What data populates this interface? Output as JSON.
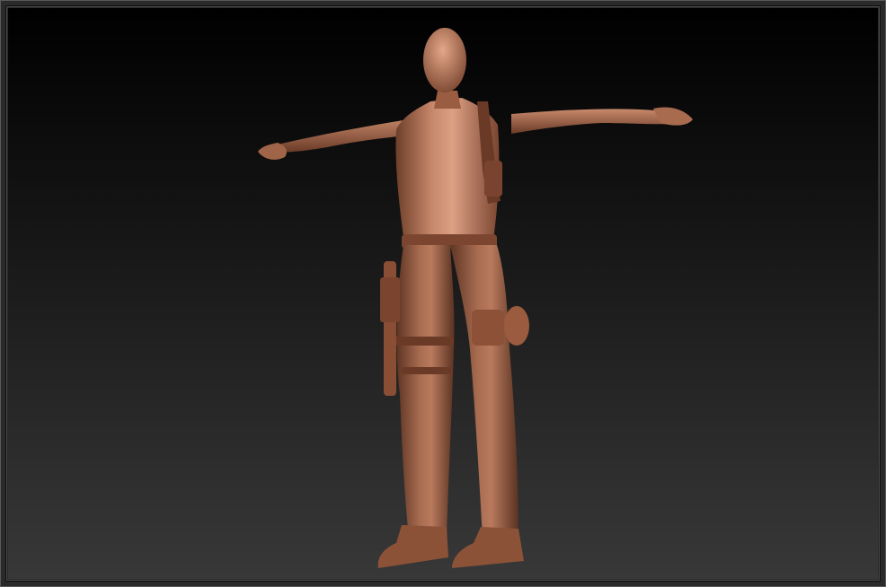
{
  "viewport": {
    "content": "sculpt-model",
    "colors": {
      "background_top": "#000000",
      "background_bottom": "#383838",
      "frame": "#2a2a2a",
      "material_base": "#a66a4d",
      "material_highlight": "#e0a07e",
      "material_shadow": "#5a3221"
    }
  }
}
